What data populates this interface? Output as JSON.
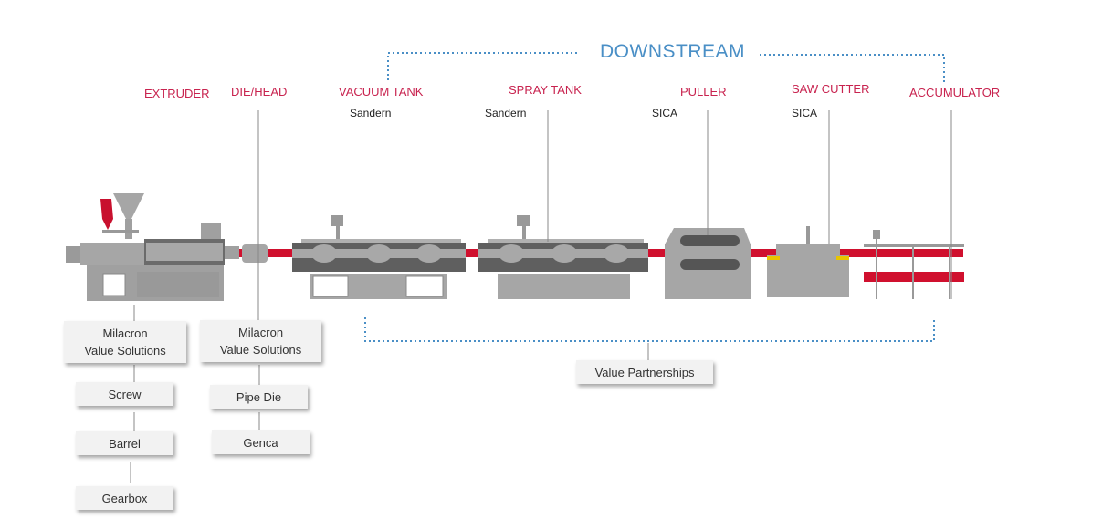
{
  "header": {
    "downstream_label": "DOWNSTREAM"
  },
  "stages": [
    {
      "label": "EXTRUDER",
      "vendor": ""
    },
    {
      "label": "DIE/HEAD",
      "vendor": ""
    },
    {
      "label": "VACUUM TANK",
      "vendor": "Sandern"
    },
    {
      "label": "SPRAY TANK",
      "vendor": "Sandern"
    },
    {
      "label": "PULLER",
      "vendor": "SICA"
    },
    {
      "label": "SAW CUTTER",
      "vendor": "SICA"
    },
    {
      "label": "ACCUMULATOR",
      "vendor": ""
    }
  ],
  "extruder_chain": [
    "Milacron\nValue Solutions",
    "Screw",
    "Barrel",
    "Gearbox"
  ],
  "die_chain": [
    "Milacron\nValue Solutions",
    "Pipe Die",
    "Genca"
  ],
  "downstream_box": "Value Partnerships",
  "colors": {
    "accent": "#c8234f",
    "downstream": "#4a8fc6",
    "machine": "#9a9a9a",
    "machine_dark": "#5a5a5a",
    "pipe": "#d0102e"
  }
}
